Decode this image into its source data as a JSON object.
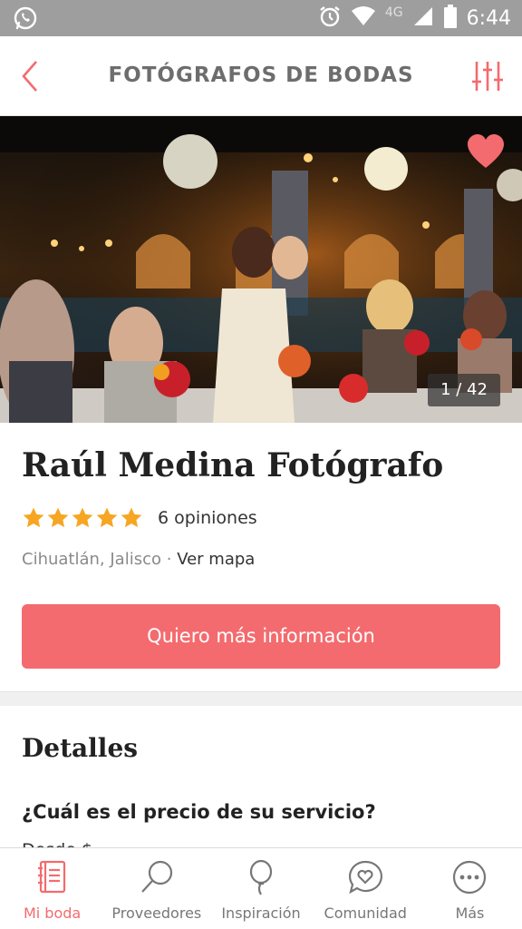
{
  "status_bar": {
    "time": "6:44",
    "network": "4G",
    "icons": [
      "whatsapp-icon",
      "alarm-icon",
      "wifi-icon",
      "signal-icon",
      "battery-icon"
    ]
  },
  "header": {
    "title": "FOTÓGRAFOS DE BODAS",
    "back_icon": "chevron-left-icon",
    "filter_icon": "sliders-icon"
  },
  "gallery": {
    "counter": "1 / 42",
    "favorite_icon": "heart-icon"
  },
  "vendor": {
    "name": "Raúl Medina Fotógrafo",
    "rating": 5,
    "rating_max": 5,
    "reviews": "6 opiniones",
    "location": "Cihuatlán, Jalisco",
    "separator": "·",
    "map_link": "Ver mapa"
  },
  "cta": {
    "label": "Quiero más información"
  },
  "details": {
    "title": "Detalles",
    "price_question": "¿Cuál es el precio de su servicio?",
    "price_partial": "Desde $"
  },
  "bottom_nav": {
    "items": [
      {
        "label": "Mi boda",
        "icon": "notebook-icon",
        "active": true
      },
      {
        "label": "Proveedores",
        "icon": "magnifier-icon",
        "active": false
      },
      {
        "label": "Inspiración",
        "icon": "balloon-icon",
        "active": false
      },
      {
        "label": "Comunidad",
        "icon": "chat-heart-icon",
        "active": false
      },
      {
        "label": "Más",
        "icon": "more-icon",
        "active": false
      }
    ]
  },
  "colors": {
    "accent": "#f36b6e",
    "star": "#f6a623",
    "status_bar": "#9e9e9e"
  }
}
